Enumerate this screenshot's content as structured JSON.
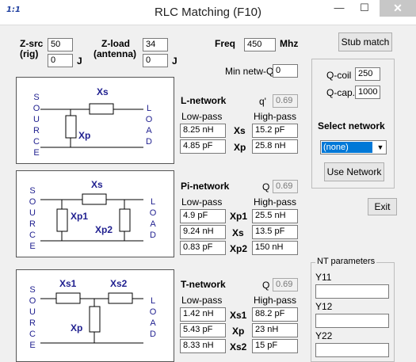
{
  "window": {
    "title": "RLC Matching (F10)",
    "icon_text": "1:1",
    "minimize": "—",
    "maximize": "☐",
    "close": "✕"
  },
  "zsrc": {
    "label_line1": "Z-src",
    "label_line2": "(rig)",
    "real": "50",
    "imag": "0",
    "unit": "J"
  },
  "zload": {
    "label_line1": "Z-load",
    "label_line2": "(antenna)",
    "real": "34",
    "imag": "0",
    "unit": "J"
  },
  "freq": {
    "label": "Freq",
    "value": "450",
    "unit": "Mhz"
  },
  "min_q": {
    "label": "Min netw-Q",
    "value": "0"
  },
  "stub_button": "Stub match",
  "q_params": {
    "coil_label": "Q-coil",
    "coil_value": "250",
    "cap_label": "Q-cap.",
    "cap_value": "1000"
  },
  "select_network": {
    "label": "Select network",
    "selected": "(none)",
    "use_button": "Use Network"
  },
  "exit_button": "Exit",
  "nt_params": {
    "title": "NT parameters",
    "y11": "Y11",
    "y12": "Y12",
    "y22": "Y22"
  },
  "diagram_text": {
    "source": "SOURCE",
    "load": "LOAD"
  },
  "col_low": "Low-pass",
  "col_high": "High-pass",
  "l_network": {
    "title": "L-network",
    "q_label": "q'",
    "q_value": "0.69",
    "components": [
      "Xs",
      "Xp"
    ],
    "rows": [
      {
        "sym": "Xs",
        "low": "8.25 nH",
        "high": "15.2 pF"
      },
      {
        "sym": "Xp",
        "low": "4.85 pF",
        "high": "25.8 nH"
      }
    ]
  },
  "pi_network": {
    "title": "Pi-network",
    "q_label": "Q",
    "q_value": "0.69",
    "components": [
      "Xs",
      "Xp1",
      "Xp2"
    ],
    "rows": [
      {
        "sym": "Xp1",
        "low": "4.9 pF",
        "high": "25.5 nH"
      },
      {
        "sym": "Xs",
        "low": "9.24 nH",
        "high": "13.5 pF"
      },
      {
        "sym": "Xp2",
        "low": "0.83 pF",
        "high": "150 nH"
      }
    ]
  },
  "t_network": {
    "title": "T-network",
    "q_label": "Q",
    "q_value": "0.69",
    "components": [
      "Xs1",
      "Xs2",
      "Xp"
    ],
    "rows": [
      {
        "sym": "Xs1",
        "low": "1.42 nH",
        "high": "88.2 pF"
      },
      {
        "sym": "Xp",
        "low": "5.43 pF",
        "high": "23 nH"
      },
      {
        "sym": "Xs2",
        "low": "8.33 nH",
        "high": "15 pF"
      }
    ]
  }
}
